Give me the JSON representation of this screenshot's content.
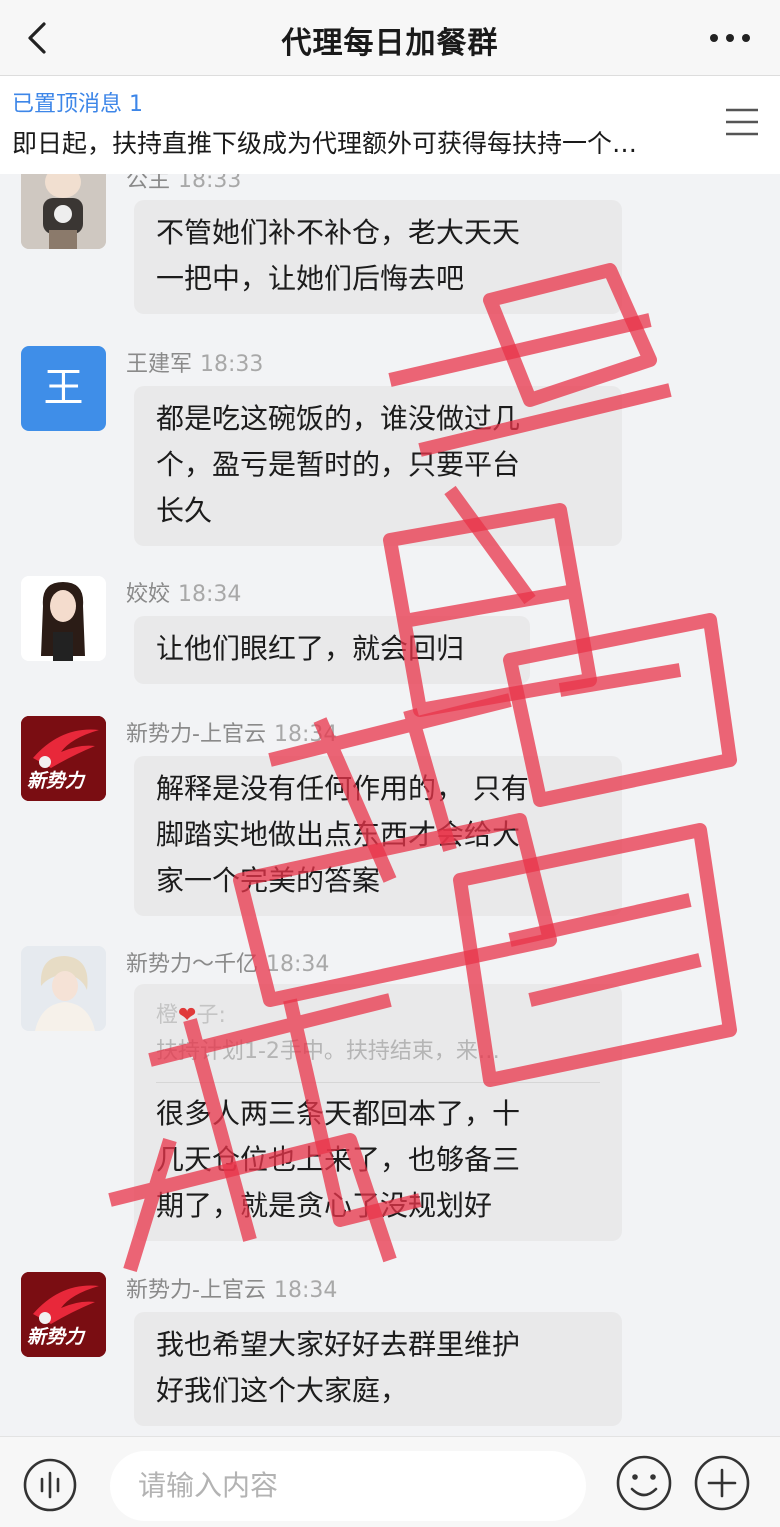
{
  "header": {
    "title": "代理每日加餐群",
    "back_icon": "chevron-left-icon",
    "more_icon": "more-horizontal-icon"
  },
  "pinned": {
    "label": "已置顶消息 1",
    "text": "即日起，扶持直推下级成为代理额外可获得每扶持一个…",
    "menu_icon": "list-menu-icon"
  },
  "messages": [
    {
      "sender": "公主",
      "time": "18:33",
      "lines": [
        "不管她们补不补仓，老大天天",
        "一把中，让她们后悔去吧"
      ]
    },
    {
      "sender": "王建军",
      "time": "18:33",
      "avatar_text": "王",
      "lines": [
        "都是吃这碗饭的，谁没做过几",
        "个，盈亏是暂时的，只要平台",
        "长久"
      ]
    },
    {
      "sender": "姣姣",
      "time": "18:34",
      "lines": [
        "让他们眼红了，就会回归"
      ]
    },
    {
      "sender": "新势力-上官云",
      "time": "18:34",
      "avatar_text": "新势力",
      "lines": [
        "解释是没有任何作用的， 只有",
        "脚踏实地做出点东西才会给大",
        "家一个完美的答案"
      ]
    },
    {
      "sender": "新势力～千亿",
      "time": "18:34",
      "quote": {
        "name_a": "橙",
        "name_b": "子:",
        "text": "扶持计划1-2手中。扶持结束，来…"
      },
      "lines": [
        "很多人两三条天都回本了，十",
        "几天仓位也上来了，也够备三",
        "期了，就是贪心了没规划好"
      ]
    },
    {
      "sender": "新势力-上官云",
      "time": "18:34",
      "avatar_text": "新势力",
      "lines": [
        "我也希望大家好好去群里维护",
        "好我们这个大家庭，"
      ]
    }
  ],
  "footer": {
    "placeholder": "请输入内容",
    "voice_icon": "voice-wave-icon",
    "emoji_icon": "smiley-icon",
    "plus_icon": "plus-circle-icon"
  },
  "watermark": {
    "text": "断崩跑路曝光",
    "color": "#e8344a"
  },
  "colors": {
    "accent": "#3d86e8",
    "bubble": "#e9e9ea",
    "background": "#f2f3f5"
  }
}
